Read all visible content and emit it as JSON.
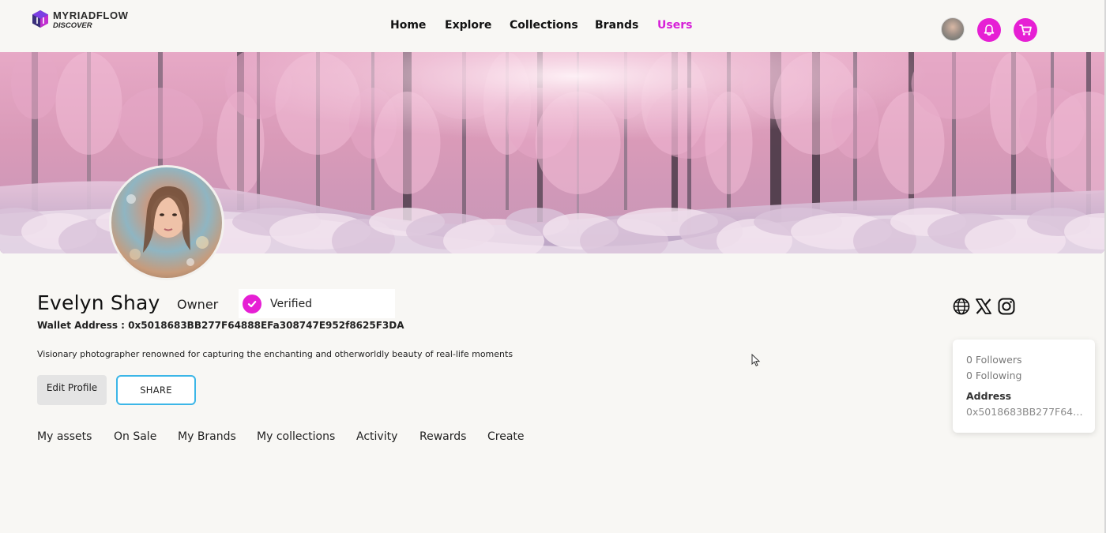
{
  "brand": {
    "name": "MYRIADFLOW",
    "tagline": "DISCOVER",
    "accent_color": "#e61fd4",
    "share_border_color": "#3cb6e7"
  },
  "nav": {
    "items": [
      {
        "label": "Home"
      },
      {
        "label": "Explore"
      },
      {
        "label": "Collections"
      },
      {
        "label": "Brands"
      },
      {
        "label": "Users",
        "active": true
      }
    ]
  },
  "header_icons": {
    "avatar": "user-avatar",
    "notifications": "bell-icon",
    "cart": "cart-icon"
  },
  "banner": {
    "description_icon": "pink-snowy-forest-banner"
  },
  "profile": {
    "name": "Evelyn Shay",
    "role": "Owner",
    "verified_label": "Verified",
    "wallet_text": "Wallet Address : 0x5018683BB277F64888EFa308747E952f8625F3DA",
    "bio": "Visionary photographer renowned for capturing the enchanting and otherworldly beauty of real-life moments"
  },
  "actions": {
    "edit_label": "Edit Profile",
    "share_label": "SHARE"
  },
  "tabs": [
    {
      "label": "My assets"
    },
    {
      "label": "On Sale"
    },
    {
      "label": "My Brands"
    },
    {
      "label": "My collections"
    },
    {
      "label": "Activity"
    },
    {
      "label": "Rewards"
    },
    {
      "label": "Create"
    }
  ],
  "social_icons": [
    "globe-icon",
    "x-icon",
    "instagram-icon"
  ],
  "stats": {
    "followers": "0 Followers",
    "following": "0 Following",
    "address_label": "Address",
    "address_value": "0x5018683BB277F648..."
  }
}
